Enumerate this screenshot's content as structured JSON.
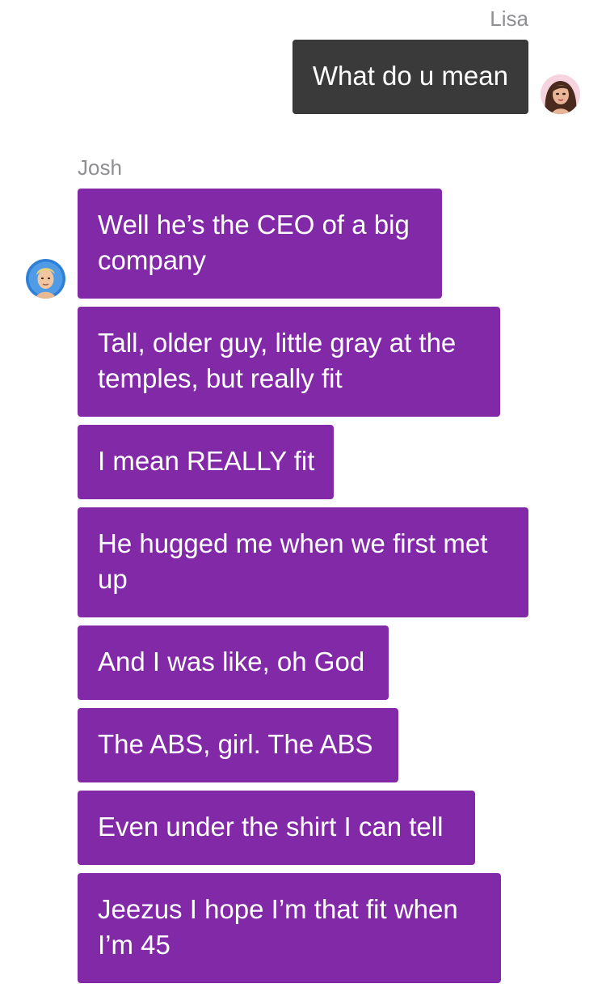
{
  "conversation": {
    "outgoing_sender": "Lisa",
    "outgoing_message": "What do u mean",
    "incoming_sender": "Josh",
    "incoming_messages": [
      "Well he’s the CEO of a big company",
      "Tall, older guy, little gray at the temples, but really fit",
      "I mean REALLY fit",
      "He hugged me when we first met up",
      "And I was like, oh God",
      "The ABS, girl. The ABS",
      "Even under the shirt I can tell",
      "Jeezus I hope I’m that fit when I’m 45"
    ]
  },
  "colors": {
    "incoming_bubble": "#8229a8",
    "outgoing_bubble": "#3a3a3a",
    "sender_name": "#8e8e93"
  },
  "icons": {
    "outgoing_avatar": "woman-avatar-icon",
    "incoming_avatar": "man-avatar-icon"
  }
}
